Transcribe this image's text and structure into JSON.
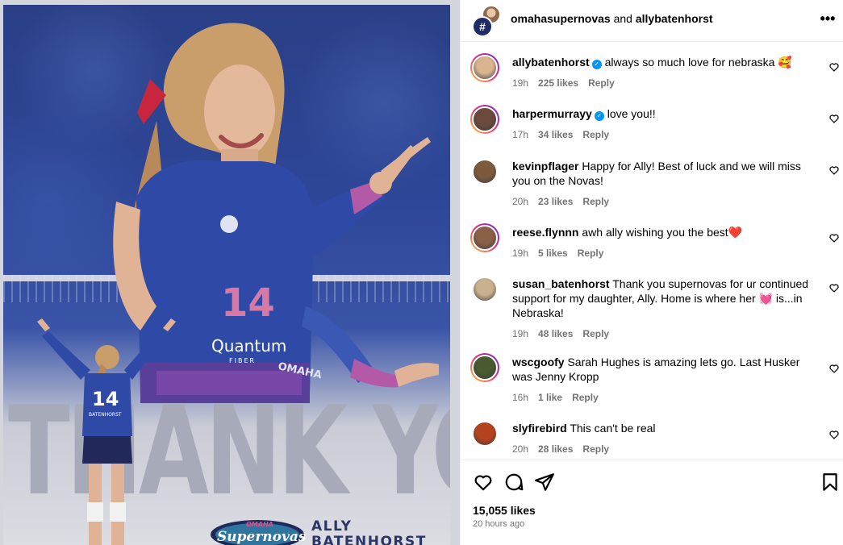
{
  "post": {
    "header": {
      "account_primary": "omahasupernovas",
      "joiner": "and",
      "account_secondary": "allybatenhorst",
      "collab_avatar_glyph": "#"
    },
    "image": {
      "headline": "THANK YOU",
      "brand_wordmark_top": "OMAHA",
      "brand_wordmark": "Supernovas",
      "player_name": "ALLY BATENHORST",
      "jersey_number": "14",
      "jersey_name": "BATENHORST",
      "jersey_sponsor": "Quantum",
      "jersey_sponsor_sub": "FIBER",
      "jersey_chest": "OMAHA",
      "colors": {
        "team_blue": "#2d4697",
        "accent_pink": "#e64c8c",
        "headline_grey": "#a7abb9"
      }
    },
    "comments": [
      {
        "user": "allybatenhorst",
        "verified": true,
        "text": "always so much love for nebraska 🥰",
        "time": "19h",
        "likes": "225 likes",
        "reply": "Reply",
        "avatar_color": "#d8b48f",
        "story_ring": true
      },
      {
        "user": "harpermurrayy",
        "verified": true,
        "text": "love you!!",
        "time": "17h",
        "likes": "34 likes",
        "reply": "Reply",
        "avatar_color": "#6b4a3d",
        "story_ring": true
      },
      {
        "user": "kevinpflager",
        "verified": false,
        "text": "Happy for Ally! Best of luck and we will miss you on the Novas!",
        "time": "20h",
        "likes": "23 likes",
        "reply": "Reply",
        "avatar_color": "#7d5a3c",
        "story_ring": false
      },
      {
        "user": "reese.flynnn",
        "verified": false,
        "text": "awh ally wishing you the best❤️",
        "time": "19h",
        "likes": "5 likes",
        "reply": "Reply",
        "avatar_color": "#8a6046",
        "story_ring": true
      },
      {
        "user": "susan_batenhorst",
        "verified": false,
        "text": "Thank you supernovas for ur continued support for my daughter, Ally. Home is where her 💓 is...in Nebraska!",
        "time": "19h",
        "likes": "48 likes",
        "reply": "Reply",
        "avatar_color": "#c9b08e",
        "story_ring": false
      },
      {
        "user": "wscgoofy",
        "verified": false,
        "text": "Sarah Hughes is amazing lets go. Last Husker was Jenny Kropp",
        "time": "16h",
        "likes": "1 like",
        "reply": "Reply",
        "avatar_color": "#4a5a2f",
        "story_ring": true
      },
      {
        "user": "slyfirebird",
        "verified": false,
        "text": "This can't be real",
        "time": "20h",
        "likes": "28 likes",
        "reply": "Reply",
        "avatar_color": "#b5431f",
        "story_ring": false
      }
    ],
    "actions": {
      "like_icon": "heart-outline-icon",
      "comment_icon": "comment-bubble-icon",
      "share_icon": "paper-plane-icon",
      "save_icon": "bookmark-icon",
      "likes_count": "15,055 likes",
      "posted_ago": "20 hours ago"
    },
    "more_options_glyph": "•••"
  }
}
